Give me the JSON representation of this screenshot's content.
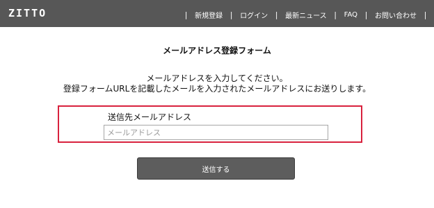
{
  "header": {
    "logo": "ZITTO",
    "nav": [
      {
        "label": "新規登録"
      },
      {
        "label": "ログイン"
      },
      {
        "label": "最新ニュース"
      },
      {
        "label": "FAQ"
      },
      {
        "label": "お問い合わせ"
      }
    ],
    "separator": "|"
  },
  "form": {
    "title": "メールアドレス登録フォーム",
    "description_line1": "メールアドレスを入力してください。",
    "description_line2": "登録フォームURLを記載したメールを入力されたメールアドレスにお送りします。",
    "field_label": "送信先メールアドレス",
    "email_placeholder": "メールアドレス",
    "email_value": "",
    "submit_label": "送信する"
  },
  "colors": {
    "header_bg": "#575757",
    "highlight_border": "#d8213d",
    "button_bg": "#5d5d5d"
  }
}
